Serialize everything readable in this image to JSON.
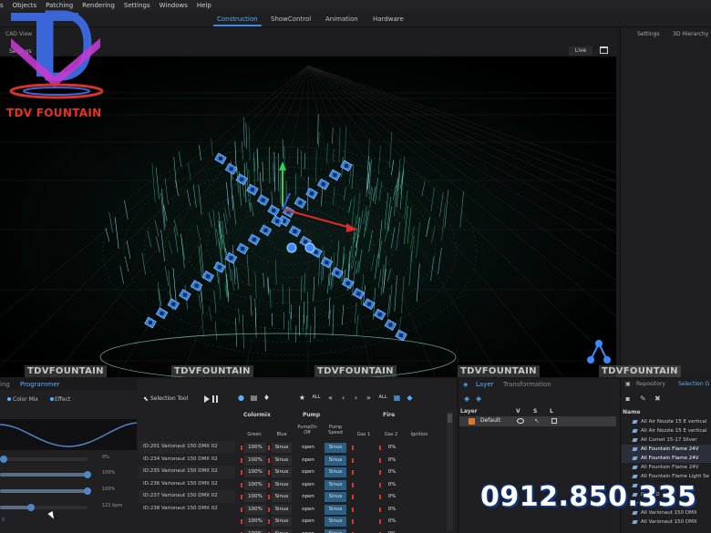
{
  "menu": [
    "s",
    "Objects",
    "Patching",
    "Rendering",
    "Settings",
    "Windows",
    "Help"
  ],
  "workspace_tabs": [
    {
      "label": "Construction",
      "active": true
    },
    {
      "label": "ShowControl",
      "active": false
    },
    {
      "label": "Animation",
      "active": false
    },
    {
      "label": "Hardware",
      "active": false
    }
  ],
  "cad": {
    "view_label": "CAD View",
    "settings_label": "Settings",
    "live_label": "Live"
  },
  "right_panel": {
    "settings_tab": "Settings",
    "hierarchy_tab": "3D Hierarchy"
  },
  "logo": {
    "letters": "TD",
    "brand": "TDV FOUNTAIN"
  },
  "watermark": "TDVFOUNTAIN",
  "programmer": {
    "tabs": [
      "ing",
      "Programmer"
    ],
    "subtabs": [
      "Color Mix",
      "Effect"
    ],
    "sliders": [
      {
        "value_label": "0%",
        "fill": 0.0
      },
      {
        "value_label": "100%",
        "fill": 1.0
      },
      {
        "value_label": "100%",
        "fill": 1.0
      },
      {
        "value_label": "121 bpm",
        "fill": 0.35
      }
    ],
    "bottom_value": "0",
    "selection_tool_label": "Selection Tool",
    "toolbar": [
      "ALL",
      "«",
      "‹",
      "›",
      "»",
      "ALL"
    ]
  },
  "table": {
    "groups": [
      "Colormix",
      "Pump",
      "Fire"
    ],
    "columns": [
      "Green",
      "Blue",
      "PumpOn Off",
      "Pump Speed",
      "Gas 1",
      "Gas 2",
      "Ignition"
    ],
    "ids": [
      "ID:201 Varionaut 150 DMX 02",
      "ID:234 Varionaut 150 DMX 02",
      "ID:235 Varionaut 150 DMX 02",
      "ID:236 Varionaut 150 DMX 02",
      "ID:237 Varionaut 150 DMX 02",
      "ID:238 Varionaut 150 DMX 02"
    ],
    "rows": [
      {
        "green": "100%",
        "blue": "Sinus",
        "pump_on": "open",
        "pump_speed": "Sinus",
        "gas2": "0%"
      },
      {
        "green": "100%",
        "blue": "Sinus",
        "pump_on": "open",
        "pump_speed": "Sinus",
        "gas2": "0%"
      },
      {
        "green": "100%",
        "blue": "Sinus",
        "pump_on": "open",
        "pump_speed": "Sinus",
        "gas2": "0%"
      },
      {
        "green": "100%",
        "blue": "Sinus",
        "pump_on": "open",
        "pump_speed": "Sinus",
        "gas2": "0%"
      },
      {
        "green": "100%",
        "blue": "Sinus",
        "pump_on": "open",
        "pump_speed": "Sinus",
        "gas2": "0%"
      },
      {
        "green": "100%",
        "blue": "Sinus",
        "pump_on": "open",
        "pump_speed": "Sinus",
        "gas2": "0%"
      },
      {
        "green": "100%",
        "blue": "Sinus",
        "pump_on": "open",
        "pump_speed": "Sinus",
        "gas2": "0%"
      },
      {
        "green": "100%",
        "blue": "Sinus",
        "pump_on": "open",
        "pump_speed": "Sinus",
        "gas2": "0%"
      }
    ]
  },
  "layer_panel": {
    "tabs": [
      "Layer",
      "Transformation"
    ],
    "header": {
      "name": "Layer",
      "v": "V",
      "s": "S",
      "l": "L"
    },
    "layers": [
      {
        "name": "Default",
        "color": "#e07a2a"
      }
    ]
  },
  "repository": {
    "tabs": [
      "Repository",
      "Selection G"
    ],
    "name_header": "Name",
    "items": [
      {
        "label": "All Air Nozzle 15 E vertical",
        "selected": false
      },
      {
        "label": "All Air Nozzle 15 E vertical",
        "selected": false
      },
      {
        "label": "All Comet 15-17 Silver",
        "selected": false
      },
      {
        "label": "All Fountain Flame 24V",
        "selected": true
      },
      {
        "label": "All Fountain Flame 24V",
        "selected": true
      },
      {
        "label": "All Fountain Flame 24V",
        "selected": false
      },
      {
        "label": "All Fountain Flame Light Se",
        "selected": false
      },
      {
        "label": "",
        "selected": false
      },
      {
        "label": "Drive D",
        "selected": false
      },
      {
        "label": "",
        "selected": false
      },
      {
        "label": "All Varionaut 150 DMX",
        "selected": false
      },
      {
        "label": "All Varionaut 150 DMX",
        "selected": false
      }
    ]
  },
  "phone": "0912.850.335",
  "colors": {
    "accent": "#2f8ff0",
    "water": "#3fd8a8",
    "nozzle": "#2f7fe0",
    "brand_red": "#e8321e"
  }
}
